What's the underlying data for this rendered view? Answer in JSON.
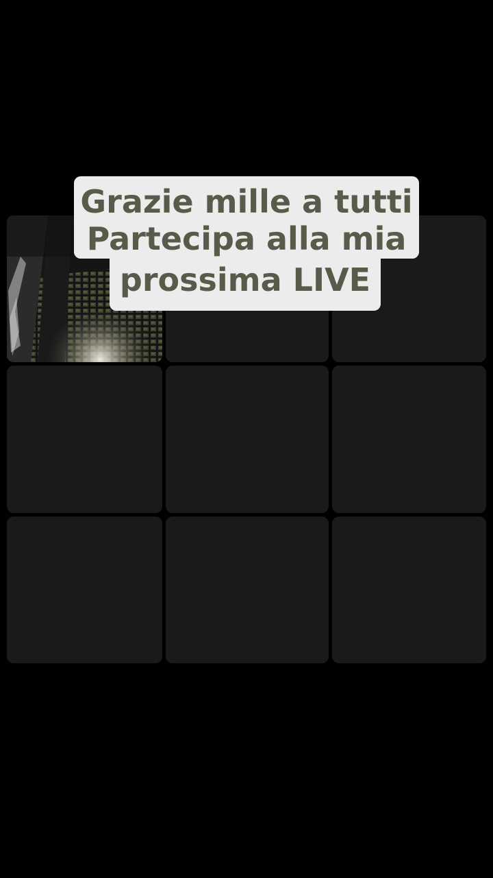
{
  "caption": {
    "lines": [
      "Grazie mille a tutti",
      "Partecipa alla mia",
      "prossima LIVE"
    ]
  },
  "grid": {
    "rows": 3,
    "columns": 3,
    "tiles": [
      {
        "content": "video"
      },
      {
        "content": "empty"
      },
      {
        "content": "empty"
      },
      {
        "content": "empty"
      },
      {
        "content": "empty"
      },
      {
        "content": "empty"
      },
      {
        "content": "empty"
      },
      {
        "content": "empty"
      },
      {
        "content": "empty"
      }
    ]
  },
  "colors": {
    "background": "#000000",
    "tile": "#1a1a1a",
    "caption_background": "#ececec",
    "caption_text": "#5a5a4a"
  }
}
